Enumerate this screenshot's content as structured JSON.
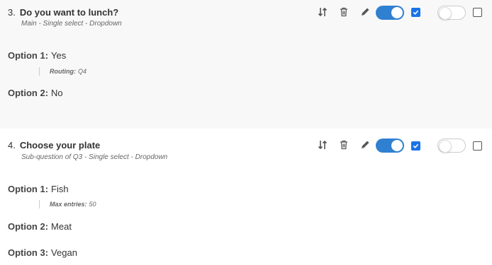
{
  "questions": [
    {
      "number": "3.",
      "title": "Do you want to lunch?",
      "subtitle": "Main - Single select - Dropdown",
      "options": [
        {
          "label": "Option 1:",
          "value": "Yes",
          "meta_label": "Routing:",
          "meta_value": "Q4"
        },
        {
          "label": "Option 2:",
          "value": "No"
        }
      ],
      "toggle_1_on": true,
      "checkbox_1_checked": true,
      "toggle_2_on": false,
      "checkbox_2_checked": false
    },
    {
      "number": "4.",
      "title": "Choose your plate",
      "subtitle": "Sub-question of Q3 - Single select - Dropdown",
      "options": [
        {
          "label": "Option 1:",
          "value": "Fish",
          "meta_label": "Max entries:",
          "meta_value": "50"
        },
        {
          "label": "Option 2:",
          "value": "Meat"
        },
        {
          "label": "Option 3:",
          "value": "Vegan"
        }
      ],
      "toggle_1_on": true,
      "checkbox_1_checked": true,
      "toggle_2_on": false,
      "checkbox_2_checked": false
    }
  ],
  "icons": {
    "reorder": "sort-arrows-icon",
    "delete": "trash-icon",
    "edit": "pencil-icon"
  },
  "colors": {
    "accent": "#2f80d0",
    "checkbox": "#1a73e8",
    "q3_background": "#f8f8f8"
  }
}
